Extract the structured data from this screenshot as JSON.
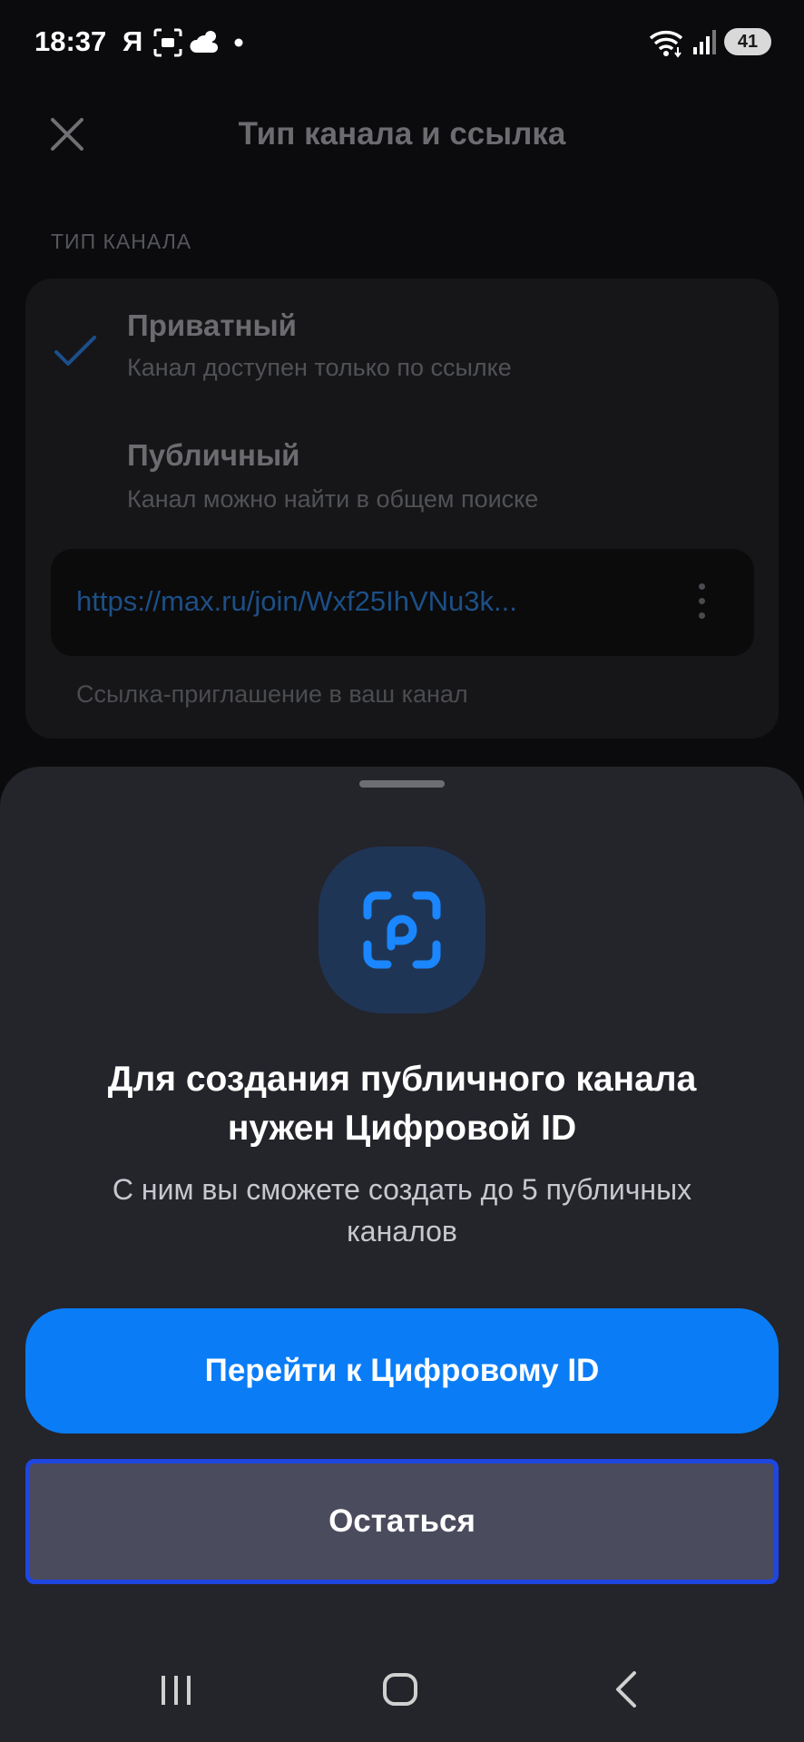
{
  "status_bar": {
    "time": "18:37",
    "yandex_letter": "Я",
    "battery": "41"
  },
  "page": {
    "title": "Тип канала и ссылка",
    "section_label": "ТИП КАНАЛА",
    "options": [
      {
        "title": "Приватный",
        "subtitle": "Канал доступен только по ссылке",
        "selected": true
      },
      {
        "title": "Публичный",
        "subtitle": "Канал можно найти в общем поиске",
        "selected": false
      }
    ],
    "invite_link": "https://max.ru/join/Wxf25IhVNu3k...",
    "invite_hint": "Ссылка-приглашение в ваш канал"
  },
  "sheet": {
    "title_line1": "Для создания публичного канала",
    "title_line2": "нужен Цифровой ID",
    "subtitle_line1": "С ним вы сможете создать до 5 публичных",
    "subtitle_line2": "каналов",
    "primary_button": "Перейти к Цифровому ID",
    "secondary_button": "Остаться"
  },
  "colors": {
    "accent": "#0a7df6",
    "sheet_bg": "#24242b",
    "focus_outline": "#1f46e0"
  }
}
